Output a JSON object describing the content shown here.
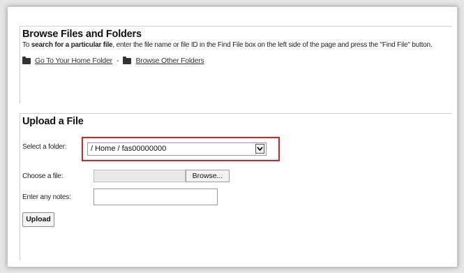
{
  "browse": {
    "title": "Browse Files and Folders",
    "desc_prefix": "To ",
    "desc_bold": "search for a particular file",
    "desc_rest": ", enter the file name or file ID in the Find File box on the left side of the page and press the \"Find File\" button.",
    "home_link": "Go To Your Home Folder",
    "separator": "-",
    "other_link": "Browse Other Folders"
  },
  "upload": {
    "title": "Upload a File",
    "folder_label": "Select a folder:",
    "folder_value": "/ Home / fas00000000",
    "file_label": "Choose a file:",
    "browse_label": "Browse...",
    "notes_label": "Enter any notes:",
    "notes_value": "",
    "upload_label": "Upload"
  },
  "colors": {
    "highlight": "#e02020"
  },
  "icons": [
    "folder-icon",
    "chevron-down-icon"
  ]
}
